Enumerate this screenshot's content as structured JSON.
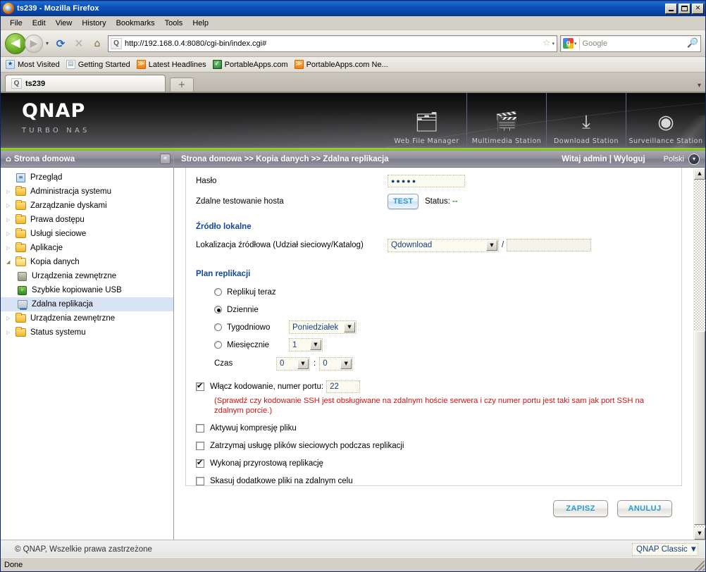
{
  "browser": {
    "window_title": "ts239 - Mozilla Firefox",
    "window_buttons": {
      "minimize": "_",
      "maximize": "□",
      "close": "✕"
    },
    "menu": [
      {
        "label": "File"
      },
      {
        "label": "Edit"
      },
      {
        "label": "View"
      },
      {
        "label": "History"
      },
      {
        "label": "Bookmarks"
      },
      {
        "label": "Tools"
      },
      {
        "label": "Help"
      }
    ],
    "nav": {
      "back": "◀",
      "forward": "▶",
      "dropdown": "▾",
      "reload": "⟳",
      "stop": "✕",
      "home": "⌂"
    },
    "url": "http://192.168.0.4:8080/cgi-bin/index.cgi#",
    "url_star": "☆",
    "url_caret": "▾",
    "search": {
      "engine_caret": "▾",
      "placeholder": "Google",
      "magnifier": "🔍"
    },
    "bookmarks": [
      {
        "label": "Most Visited",
        "icon": "star-icon"
      },
      {
        "label": "Getting Started",
        "icon": "page-icon"
      },
      {
        "label": "Latest Headlines",
        "icon": "rss-icon"
      },
      {
        "label": "PortableApps.com",
        "icon": "shield-icon"
      },
      {
        "label": "PortableApps.com Ne...",
        "icon": "rss-icon"
      }
    ],
    "tabs": [
      {
        "label": "ts239"
      }
    ],
    "new_tab": "+",
    "tab_list": "▾",
    "status": "Done"
  },
  "banner": {
    "brand": "QNAP",
    "brand_sub": "TURBO NAS",
    "stations": [
      {
        "label": "Web File Manager",
        "icon": "file-search-icon",
        "glyph": "🗂"
      },
      {
        "label": "Multimedia Station",
        "icon": "multimedia-icon",
        "glyph": "🎬"
      },
      {
        "label": "Download Station",
        "icon": "download-icon",
        "glyph": "⤓"
      },
      {
        "label": "Surveillance Station",
        "icon": "camera-icon",
        "glyph": "◉"
      }
    ]
  },
  "sidebar": {
    "header": "Strona domowa",
    "header_icon": "home-icon",
    "collapse_icon": "«",
    "items": [
      {
        "label": "Przegląd",
        "icon": "overview-icon",
        "arrow": "",
        "level": 0
      },
      {
        "label": "Administracja systemu",
        "icon": "folder-icon",
        "arrow": "▷",
        "level": 0
      },
      {
        "label": "Zarządzanie dyskami",
        "icon": "folder-icon",
        "arrow": "▷",
        "level": 0
      },
      {
        "label": "Prawa dostępu",
        "icon": "folder-icon",
        "arrow": "▷",
        "level": 0
      },
      {
        "label": "Usługi sieciowe",
        "icon": "folder-icon",
        "arrow": "▷",
        "level": 0
      },
      {
        "label": "Aplikacje",
        "icon": "folder-icon",
        "arrow": "▷",
        "level": 0
      },
      {
        "label": "Kopia danych",
        "icon": "folder-open-icon",
        "arrow": "◢",
        "level": 0,
        "expanded": true
      },
      {
        "label": "Urządzenia zewnętrzne",
        "icon": "external-device-icon",
        "arrow": "",
        "level": 1
      },
      {
        "label": "Szybkie kopiowanie USB",
        "icon": "usb-icon",
        "arrow": "",
        "level": 1
      },
      {
        "label": "Zdalna replikacja",
        "icon": "replication-icon",
        "arrow": "",
        "level": 1,
        "selected": true
      },
      {
        "label": "Urządzenia zewnętrzne",
        "icon": "folder-icon",
        "arrow": "▷",
        "level": 0
      },
      {
        "label": "Status systemu",
        "icon": "folder-icon",
        "arrow": "▷",
        "level": 0
      }
    ]
  },
  "breadcrumb": {
    "path": "Strona domowa >> Kopia danych >> Zdalna replikacja",
    "user": "Witaj admin | Wyloguj",
    "language": "Polski",
    "language_caret": "▾"
  },
  "form": {
    "password_label": "Hasło",
    "password_value": "●●●●●",
    "host_test_label": "Zdalne testowanie hosta",
    "test_button": "TEST",
    "status_label": "Status:",
    "status_value": "--",
    "local_source_title": "Źródło lokalne",
    "source_location_label": "Lokalizacja źródłowa (Udział sieciowy/Katalog)",
    "source_share_value": "Qdownload",
    "source_slash": "/",
    "source_path_value": "",
    "plan_title": "Plan replikacji",
    "schedule": [
      {
        "label": "Replikuj teraz",
        "selected": false
      },
      {
        "label": "Dziennie",
        "selected": true
      },
      {
        "label": "Tygodniowo",
        "selected": false,
        "value": "Poniedziałek"
      },
      {
        "label": "Miesięcznie",
        "selected": false,
        "value": "1"
      }
    ],
    "time_label": "Czas",
    "time_hour": "0",
    "time_minute": "0",
    "time_separator": ":",
    "options": [
      {
        "label": "Włącz kodowanie, numer portu:",
        "checked": true,
        "port": "22"
      },
      {
        "label": "Aktywuj kompresję pliku",
        "checked": false
      },
      {
        "label": "Zatrzymaj usługę plików sieciowych podczas replikacji",
        "checked": false
      },
      {
        "label": "Wykonaj przyrostową replikację",
        "checked": true
      },
      {
        "label": "Skasuj dodatkowe pliki na zdalnym celu",
        "checked": false
      }
    ],
    "warning": "(Sprawdź czy kodowanie SSH jest obsługiwane na zdalnym hoście serwera i czy numer portu jest taki sam jak port SSH na zdalnym porcie.)",
    "save_button": "ZAPISZ",
    "cancel_button": "ANULUJ",
    "scroll_up": "▲",
    "scroll_down": "▼",
    "select_caret": "▼"
  },
  "footer": {
    "copyright": "© QNAP, Wszelkie prawa zastrzeżone",
    "theme": "QNAP Classic",
    "theme_caret": "▼"
  },
  "colors": {
    "accent_blue": "#2a9ad6",
    "link_blue": "#12479e",
    "warn_red": "#d01414",
    "brand_green": "#9ed13f",
    "status_green": "#2fa02f"
  }
}
